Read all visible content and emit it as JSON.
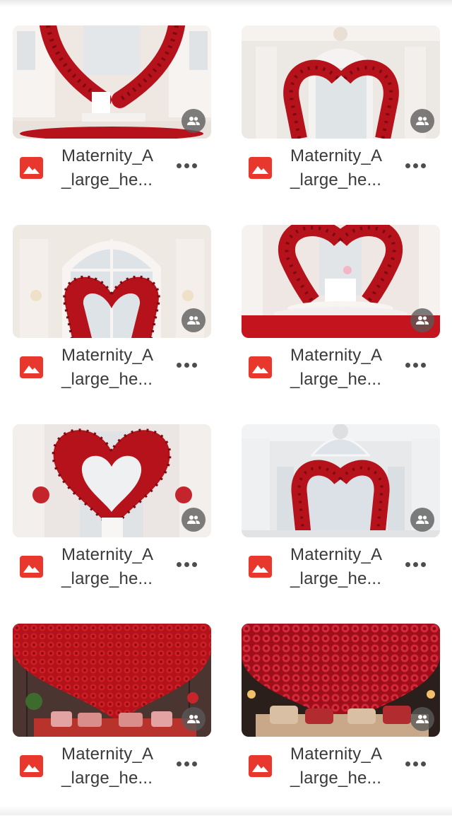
{
  "files": [
    {
      "name_line1": "Maternity_A",
      "name_line2": "_large_he...",
      "type_icon": "image-file-icon",
      "shared_icon": "people-icon",
      "scene": "arch"
    },
    {
      "name_line1": "Maternity_A",
      "name_line2": "_large_he...",
      "type_icon": "image-file-icon",
      "shared_icon": "people-icon",
      "scene": "hall"
    },
    {
      "name_line1": "Maternity_A",
      "name_line2": "_large_he...",
      "type_icon": "image-file-icon",
      "shared_icon": "people-icon",
      "scene": "window"
    },
    {
      "name_line1": "Maternity_A",
      "name_line2": "_large_he...",
      "type_icon": "image-file-icon",
      "shared_icon": "people-icon",
      "scene": "stage"
    },
    {
      "name_line1": "Maternity_A",
      "name_line2": "_large_he...",
      "type_icon": "image-file-icon",
      "shared_icon": "people-icon",
      "scene": "bigheart"
    },
    {
      "name_line1": "Maternity_A",
      "name_line2": "_large_he...",
      "type_icon": "image-file-icon",
      "shared_icon": "people-icon",
      "scene": "greyhall"
    },
    {
      "name_line1": "Maternity_A",
      "name_line2": "_large_he...",
      "type_icon": "image-file-icon",
      "shared_icon": "people-icon",
      "scene": "rosewall"
    },
    {
      "name_line1": "Maternity_A",
      "name_line2": "_large_he...",
      "type_icon": "image-file-icon",
      "shared_icon": "people-icon",
      "scene": "rosewall2"
    }
  ],
  "colors": {
    "file_icon": "#e8372c",
    "rose": "#b5121b",
    "rose_dark": "#7d0a10",
    "text": "#3a3a3a"
  }
}
